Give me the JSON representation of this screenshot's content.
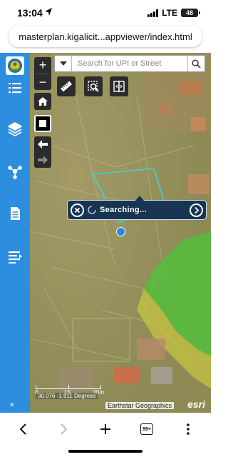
{
  "status_bar": {
    "time": "13:04",
    "network": "LTE",
    "battery": "48",
    "icons": [
      "location-arrow-icon",
      "signal-icon",
      "battery-icon"
    ]
  },
  "browser": {
    "url": "masterplan.kigalicit...appviewer/index.html"
  },
  "sidebar": {
    "items": [
      {
        "name": "logo",
        "icon": "city-emblem-icon"
      },
      {
        "name": "layer-list",
        "icon": "list-icon"
      },
      {
        "name": "basemap",
        "icon": "layers-icon"
      },
      {
        "name": "share",
        "icon": "share-nodes-icon"
      },
      {
        "name": "document",
        "icon": "document-icon"
      },
      {
        "name": "legend",
        "icon": "legend-list-icon"
      }
    ],
    "expand_label": "»"
  },
  "map": {
    "zoom_in_label": "+",
    "zoom_out_label": "−",
    "search": {
      "placeholder": "Search for UPI or Street"
    },
    "tools": [
      "measure-icon",
      "search-map-icon",
      "split-view-icon"
    ],
    "nav_buttons": [
      "home-icon",
      "fullscreen-icon",
      "back-arrow-icon",
      "forward-arrow-icon"
    ],
    "popup": {
      "text": "Searching..."
    },
    "scale": {
      "ticks": [
        "0",
        "15",
        "30m"
      ]
    },
    "coordinates": "30.076 -1.911 Degrees",
    "attribution": "Earthstar Geographics",
    "logo": "esri",
    "colors": {
      "parcel_highlight": "#3fd4d4",
      "zoning_green": "#4cc43a",
      "zoning_yellow": "#d8d83a",
      "popup_bg": "#173552",
      "sidebar_bg": "#2d8dde"
    }
  },
  "bottom_nav": {
    "tabs_count": "99+",
    "icons": [
      "back-icon",
      "forward-icon",
      "new-tab-icon",
      "tabs-icon",
      "more-icon"
    ]
  }
}
